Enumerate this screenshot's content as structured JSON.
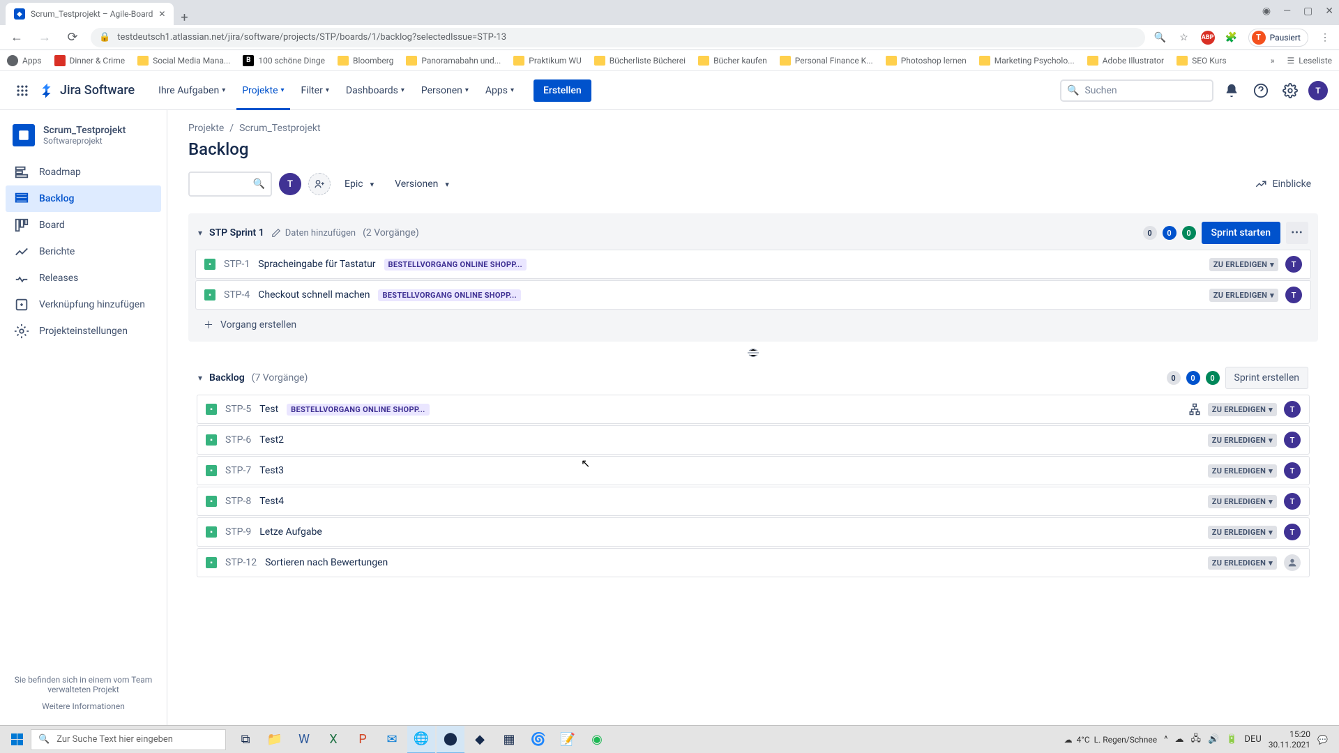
{
  "browser": {
    "tab_title": "Scrum_Testprojekt – Agile-Board",
    "url": "testdeutsch1.atlassian.net/jira/software/projects/STP/boards/1/backlog?selectedIssue=STP-13",
    "profile_status": "Pausiert",
    "profile_initial": "T",
    "bookmarks": [
      {
        "label": "Apps",
        "type": "apps"
      },
      {
        "label": "Dinner & Crime",
        "type": "page"
      },
      {
        "label": "Social Media Mana...",
        "type": "folder"
      },
      {
        "label": "100 schöne Dinge",
        "type": "page"
      },
      {
        "label": "Bloomberg",
        "type": "folder"
      },
      {
        "label": "Panoramabahn und...",
        "type": "folder"
      },
      {
        "label": "Praktikum WU",
        "type": "folder"
      },
      {
        "label": "Bücherliste Bücherei",
        "type": "folder"
      },
      {
        "label": "Bücher kaufen",
        "type": "folder"
      },
      {
        "label": "Personal Finance K...",
        "type": "folder"
      },
      {
        "label": "Photoshop lernen",
        "type": "folder"
      },
      {
        "label": "Marketing Psycholo...",
        "type": "folder"
      },
      {
        "label": "Adobe Illustrator",
        "type": "folder"
      },
      {
        "label": "SEO Kurs",
        "type": "folder"
      }
    ],
    "reading_list": "Leseliste"
  },
  "jira_header": {
    "logo_text": "Jira Software",
    "nav": [
      {
        "label": "Ihre Aufgaben",
        "active": false
      },
      {
        "label": "Projekte",
        "active": true
      },
      {
        "label": "Filter",
        "active": false
      },
      {
        "label": "Dashboards",
        "active": false
      },
      {
        "label": "Personen",
        "active": false
      },
      {
        "label": "Apps",
        "active": false
      }
    ],
    "create_label": "Erstellen",
    "search_placeholder": "Suchen",
    "avatar_initial": "T"
  },
  "sidebar": {
    "project_name": "Scrum_Testprojekt",
    "project_type": "Softwareprojekt",
    "items": [
      {
        "label": "Roadmap",
        "icon": "roadmap"
      },
      {
        "label": "Backlog",
        "icon": "backlog",
        "active": true
      },
      {
        "label": "Board",
        "icon": "board"
      },
      {
        "label": "Berichte",
        "icon": "reports"
      },
      {
        "label": "Releases",
        "icon": "releases"
      },
      {
        "label": "Verknüpfung hinzufügen",
        "icon": "link"
      },
      {
        "label": "Projekteinstellungen",
        "icon": "settings"
      }
    ],
    "footer_text": "Sie befinden sich in einem vom Team verwalteten Projekt",
    "footer_link": "Weitere Informationen"
  },
  "main": {
    "breadcrumb_projects": "Projekte",
    "breadcrumb_project": "Scrum_Testprojekt",
    "page_title": "Backlog",
    "filter_epic": "Epic",
    "filter_versions": "Versionen",
    "insights_label": "Einblicke",
    "avatar_initial": "T"
  },
  "sprint": {
    "title": "STP Sprint 1",
    "add_dates": "Daten hinzufügen",
    "count_text": "(2 Vorgänge)",
    "badges": {
      "gray": "0",
      "blue": "0",
      "green": "0"
    },
    "start_label": "Sprint starten",
    "issues": [
      {
        "key": "STP-1",
        "summary": "Spracheingabe für Tastatur",
        "epic": "BESTELLVORGANG ONLINE SHOPP...",
        "status": "ZU ERLEDIGEN",
        "assignee": "T"
      },
      {
        "key": "STP-4",
        "summary": "Checkout schnell machen",
        "epic": "BESTELLVORGANG ONLINE SHOPP...",
        "status": "ZU ERLEDIGEN",
        "assignee": "T"
      }
    ],
    "create_issue": "Vorgang erstellen"
  },
  "backlog": {
    "title": "Backlog",
    "count_text": "(7 Vorgänge)",
    "badges": {
      "gray": "0",
      "blue": "0",
      "green": "0"
    },
    "create_sprint": "Sprint erstellen",
    "issues": [
      {
        "key": "STP-5",
        "summary": "Test",
        "epic": "BESTELLVORGANG ONLINE SHOPP...",
        "status": "ZU ERLEDIGEN",
        "assignee": "T",
        "has_children": true
      },
      {
        "key": "STP-6",
        "summary": "Test2",
        "epic": null,
        "status": "ZU ERLEDIGEN",
        "assignee": "T"
      },
      {
        "key": "STP-7",
        "summary": "Test3",
        "epic": null,
        "status": "ZU ERLEDIGEN",
        "assignee": "T"
      },
      {
        "key": "STP-8",
        "summary": "Test4",
        "epic": null,
        "status": "ZU ERLEDIGEN",
        "assignee": "T"
      },
      {
        "key": "STP-9",
        "summary": "Letze Aufgabe",
        "epic": null,
        "status": "ZU ERLEDIGEN",
        "assignee": "T"
      },
      {
        "key": "STP-12",
        "summary": "Sortieren nach Bewertungen",
        "epic": null,
        "status": "ZU ERLEDIGEN",
        "assignee": null
      }
    ]
  },
  "taskbar": {
    "search_placeholder": "Zur Suche Text hier eingeben",
    "weather_temp": "4°C",
    "weather_text": "L. Regen/Schnee",
    "lang": "DEU",
    "time": "15:20",
    "date": "30.11.2021"
  }
}
